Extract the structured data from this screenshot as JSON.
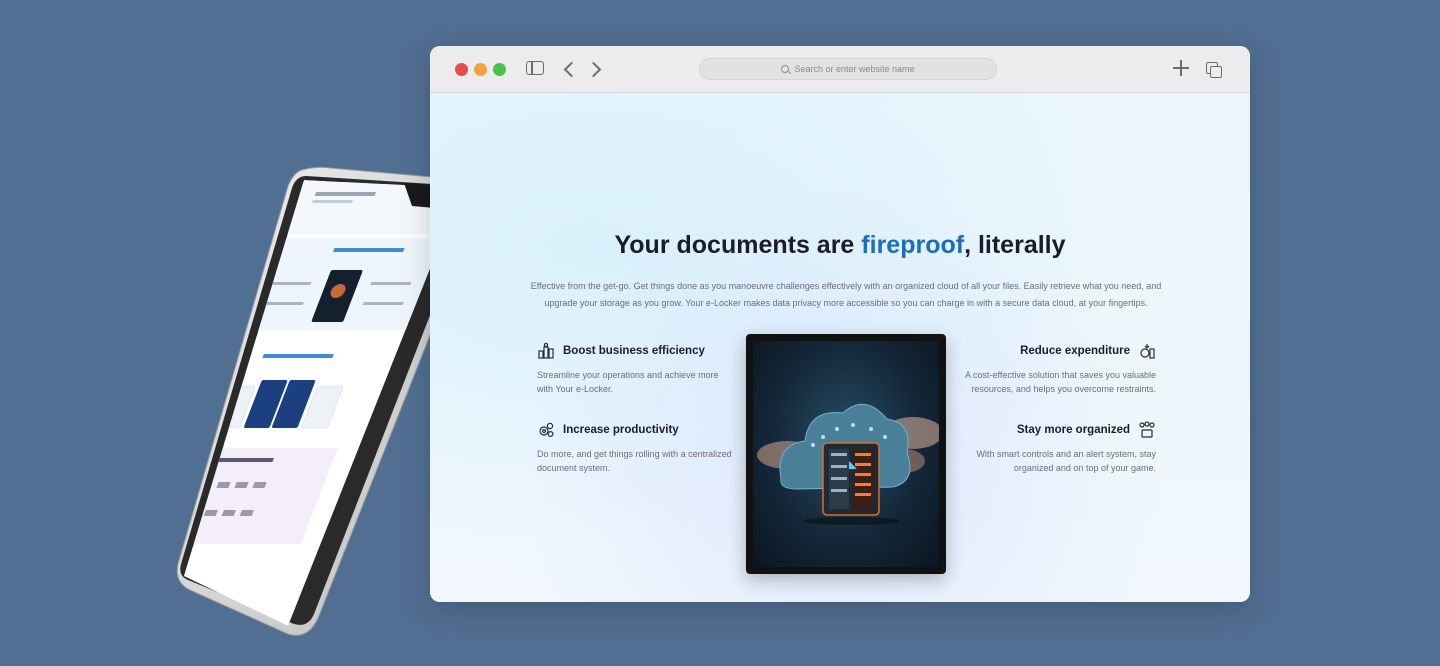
{
  "browser": {
    "url_placeholder": "Search or enter website name",
    "icons": [
      "sidebar-icon",
      "chevron-left-icon",
      "chevron-right-icon",
      "search-icon",
      "plus-icon",
      "tabs-icon"
    ]
  },
  "hero": {
    "title_before": "Your documents are ",
    "title_accent": "fireproof",
    "title_after": ", literally",
    "accent_color": "#1c6cc0",
    "description": "Effective from the get-go. Get things done as you manoeuvre challenges effectively with an organized cloud of all your files. Easily retrieve what you need, and upgrade your storage as you grow. Your e-Locker makes data privacy more accessible so you can charge in with a secure data cloud, at your fingertips."
  },
  "features": [
    {
      "title": "Boost business efficiency",
      "text": "Streamline your operations and achieve more with Your e-Locker.",
      "icon": "blocks-icon"
    },
    {
      "title": "Increase productivity",
      "text": "Do more, and get things rolling with a centralized document system.",
      "icon": "gears-icon"
    },
    {
      "title": "Reduce expenditure",
      "text": "A cost-effective solution that saves you valuable resources, and helps you overcome restraints.",
      "icon": "coins-icon"
    },
    {
      "title": "Stay more organized",
      "text": "With smart controls and an alert system, stay organized and on top of your game.",
      "icon": "organize-icon"
    }
  ],
  "colors": {
    "background": "#516f92",
    "traffic_red": "#ee4a4a",
    "traffic_yellow": "#f3a03d",
    "traffic_green": "#45c34e"
  }
}
